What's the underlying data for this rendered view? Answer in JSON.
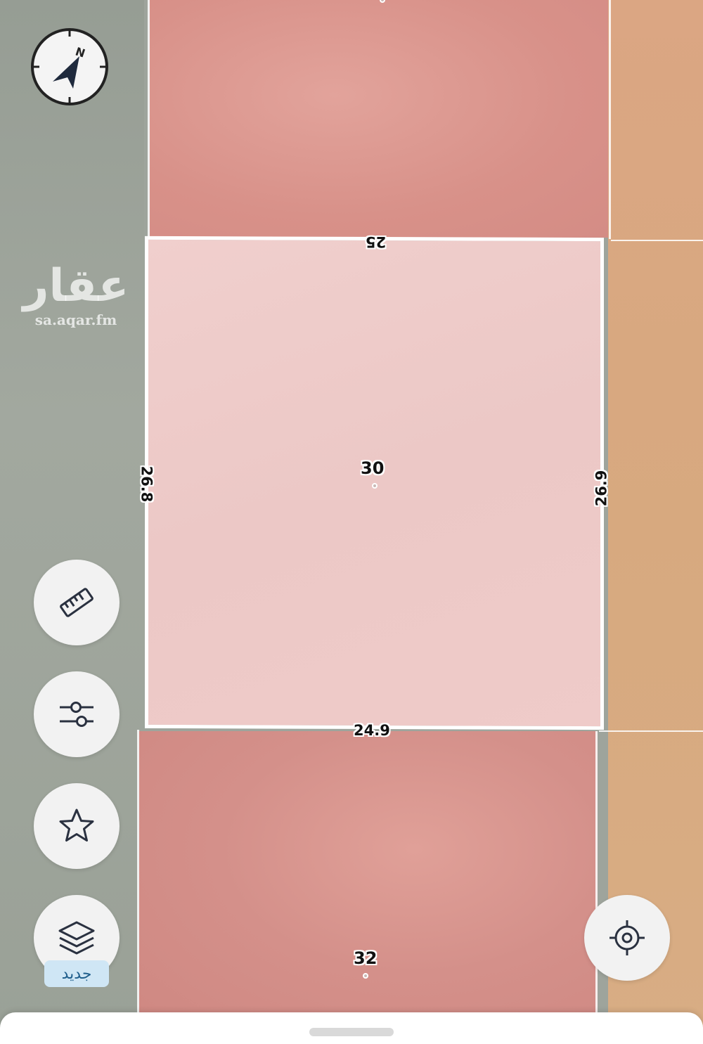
{
  "map": {
    "selected_plot": {
      "number": "30",
      "dimensions": {
        "top": "25",
        "bottom": "24.9",
        "left": "26.8",
        "right": "26.9"
      }
    },
    "other_plots": [
      {
        "number": "32"
      }
    ],
    "colors": {
      "street": "#9ea49c",
      "residential_parcel": "#d8918a",
      "selected_parcel": "#eecbc9",
      "commercial_parcel": "#d8a980",
      "parcel_border": "#ffffff"
    }
  },
  "watermark": {
    "logo": "عقار",
    "url": "sa.aqar.fm"
  },
  "controls": {
    "compass": {
      "label": "N",
      "icon": "compass-icon"
    },
    "measure": {
      "icon": "ruler-icon"
    },
    "filters": {
      "icon": "sliders-icon"
    },
    "favorites": {
      "icon": "star-icon"
    },
    "layers": {
      "icon": "layers-icon",
      "badge": "جديد"
    },
    "locate": {
      "icon": "crosshair-icon"
    }
  }
}
